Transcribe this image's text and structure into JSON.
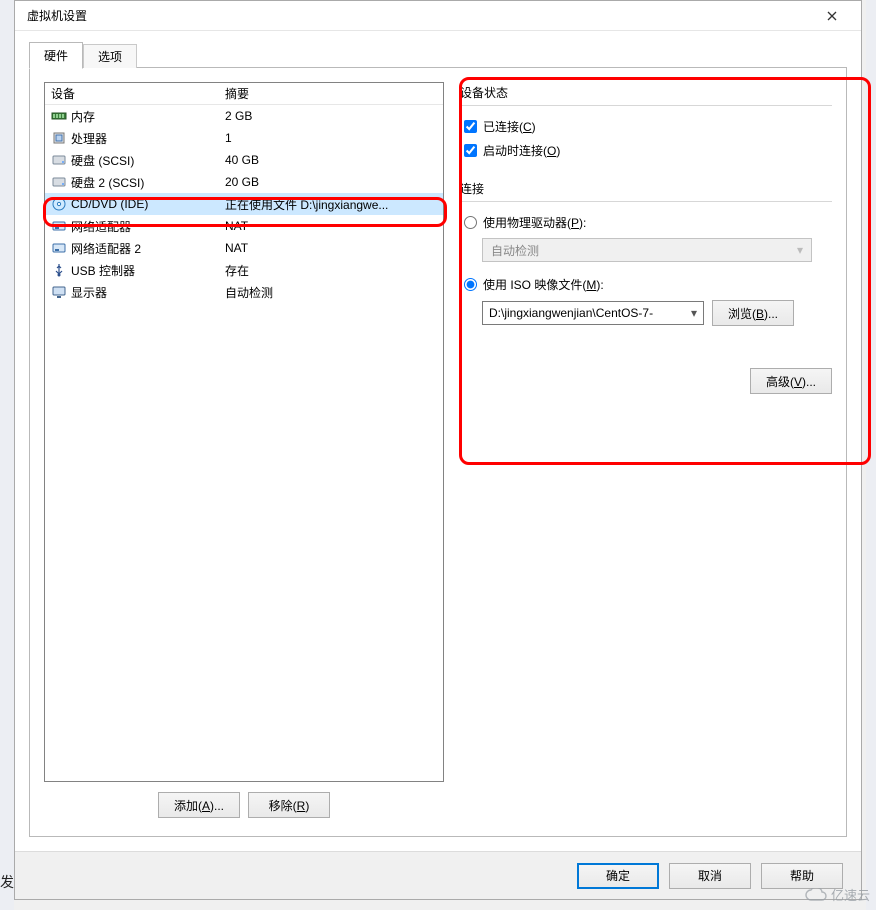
{
  "window": {
    "title": "虚拟机设置"
  },
  "tabs": {
    "hardware": "硬件",
    "options": "选项"
  },
  "listHeader": {
    "device": "设备",
    "summary": "摘要"
  },
  "devices": [
    {
      "name": "内存",
      "summary": "2 GB",
      "icon": "memory"
    },
    {
      "name": "处理器",
      "summary": "1",
      "icon": "cpu"
    },
    {
      "name": "硬盘 (SCSI)",
      "summary": "40 GB",
      "icon": "hdd"
    },
    {
      "name": "硬盘 2 (SCSI)",
      "summary": "20 GB",
      "icon": "hdd"
    },
    {
      "name": "CD/DVD (IDE)",
      "summary": "正在使用文件 D:\\jingxiangwe...",
      "icon": "cd",
      "selected": true
    },
    {
      "name": "网络适配器",
      "summary": "NAT",
      "icon": "nic"
    },
    {
      "name": "网络适配器 2",
      "summary": "NAT",
      "icon": "nic"
    },
    {
      "name": "USB 控制器",
      "summary": "存在",
      "icon": "usb"
    },
    {
      "name": "显示器",
      "summary": "自动检测",
      "icon": "display"
    }
  ],
  "leftButtons": {
    "add": {
      "text": "添加(",
      "key": "A",
      "suffix": ")..."
    },
    "remove": {
      "text": "移除(",
      "key": "R",
      "suffix": ")"
    }
  },
  "right": {
    "statusTitle": "设备状态",
    "connected": {
      "label": "已连接(",
      "key": "C",
      "suffix": ")",
      "checked": true
    },
    "connectAtPower": {
      "label": "启动时连接(",
      "key": "O",
      "suffix": ")",
      "checked": true
    },
    "connectionTitle": "连接",
    "usePhysical": {
      "label": "使用物理驱动器(",
      "key": "P",
      "suffix": "):",
      "checked": false
    },
    "physicalValue": "自动检测",
    "useIso": {
      "label": "使用 ISO 映像文件(",
      "key": "M",
      "suffix": "):",
      "checked": true
    },
    "isoPath": "D:\\jingxiangwenjian\\CentOS-7-",
    "browse": {
      "text": "浏览(",
      "key": "B",
      "suffix": ")..."
    },
    "advanced": {
      "text": "高级(",
      "key": "V",
      "suffix": ")..."
    }
  },
  "footer": {
    "ok": "确定",
    "cancel": "取消",
    "help": "帮助"
  },
  "bg": {
    "leftBottom": "发"
  },
  "watermark": "亿速云"
}
